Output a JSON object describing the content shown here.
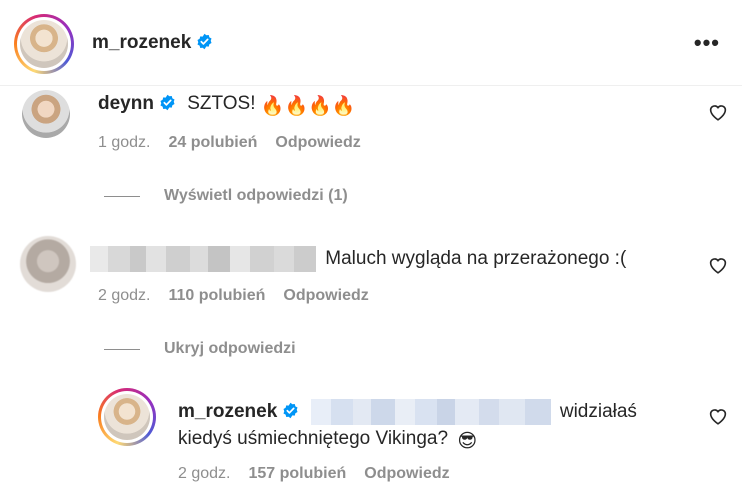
{
  "post_header": {
    "username": "m_rozenek",
    "more_label": "•••"
  },
  "comments": [
    {
      "username": "deynn",
      "text": "SZTOS!",
      "emoji": "🔥🔥🔥🔥",
      "time": "1 godz.",
      "likes": "24 polubień",
      "reply_label": "Odpowiedz",
      "thread_toggle": "Wyświetl odpowiedzi (1)"
    },
    {
      "username_hidden": true,
      "text": "Maluch wygląda na przerażonego :(",
      "time": "2 godz.",
      "likes": "110 polubień",
      "reply_label": "Odpowiedz",
      "thread_toggle": "Ukryj odpowiedzi"
    }
  ],
  "reply": {
    "username": "m_rozenek",
    "text_line1": "widziałaś",
    "text_line2": "kiedyś uśmiechniętego Vikinga?",
    "emoji": "😎",
    "time": "2 godz.",
    "likes": "157 polubień",
    "reply_label": "Odpowiedz"
  },
  "colors": {
    "text": "#262626",
    "secondary": "#8e8e8e",
    "verified": "#0095f6"
  }
}
